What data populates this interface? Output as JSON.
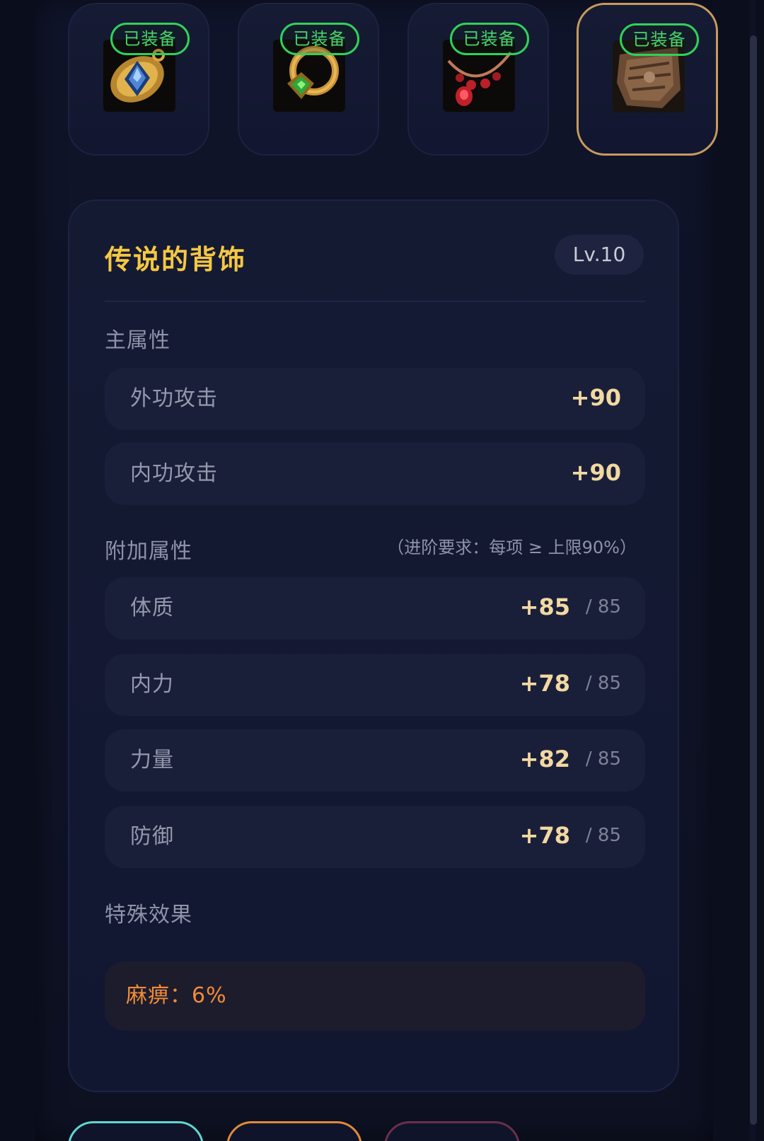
{
  "slots": [
    {
      "badge": "已装备",
      "icon": "gold-sapphire-amulet-icon",
      "selected": false
    },
    {
      "badge": "已装备",
      "icon": "emerald-ring-pendant-icon",
      "selected": false
    },
    {
      "badge": "已装备",
      "icon": "ruby-necklace-icon",
      "selected": false
    },
    {
      "badge": "已装备",
      "icon": "bronze-back-ornament-icon",
      "selected": true
    }
  ],
  "item": {
    "title": "传说的背饰",
    "level": "Lv.10"
  },
  "main_attrs": {
    "label": "主属性",
    "rows": [
      {
        "name": "外功攻击",
        "value": "+90"
      },
      {
        "name": "内功攻击",
        "value": "+90"
      }
    ]
  },
  "extra_attrs": {
    "label": "附加属性",
    "note": "（进阶要求：每项 ≥ 上限90%）",
    "rows": [
      {
        "name": "体质",
        "value": "+85",
        "max": "/ 85"
      },
      {
        "name": "内力",
        "value": "+78",
        "max": "/ 85"
      },
      {
        "name": "力量",
        "value": "+82",
        "max": "/ 85"
      },
      {
        "name": "防御",
        "value": "+78",
        "max": "/ 85"
      }
    ]
  },
  "special": {
    "label": "特殊效果",
    "effect": "麻痹：6%"
  },
  "colors": {
    "title": "#f5c842",
    "badge_green": "#2fd25a",
    "selected_border": "#c79b5c",
    "effect_orange": "#f28b3a",
    "value_gold": "#f2d8a2"
  }
}
